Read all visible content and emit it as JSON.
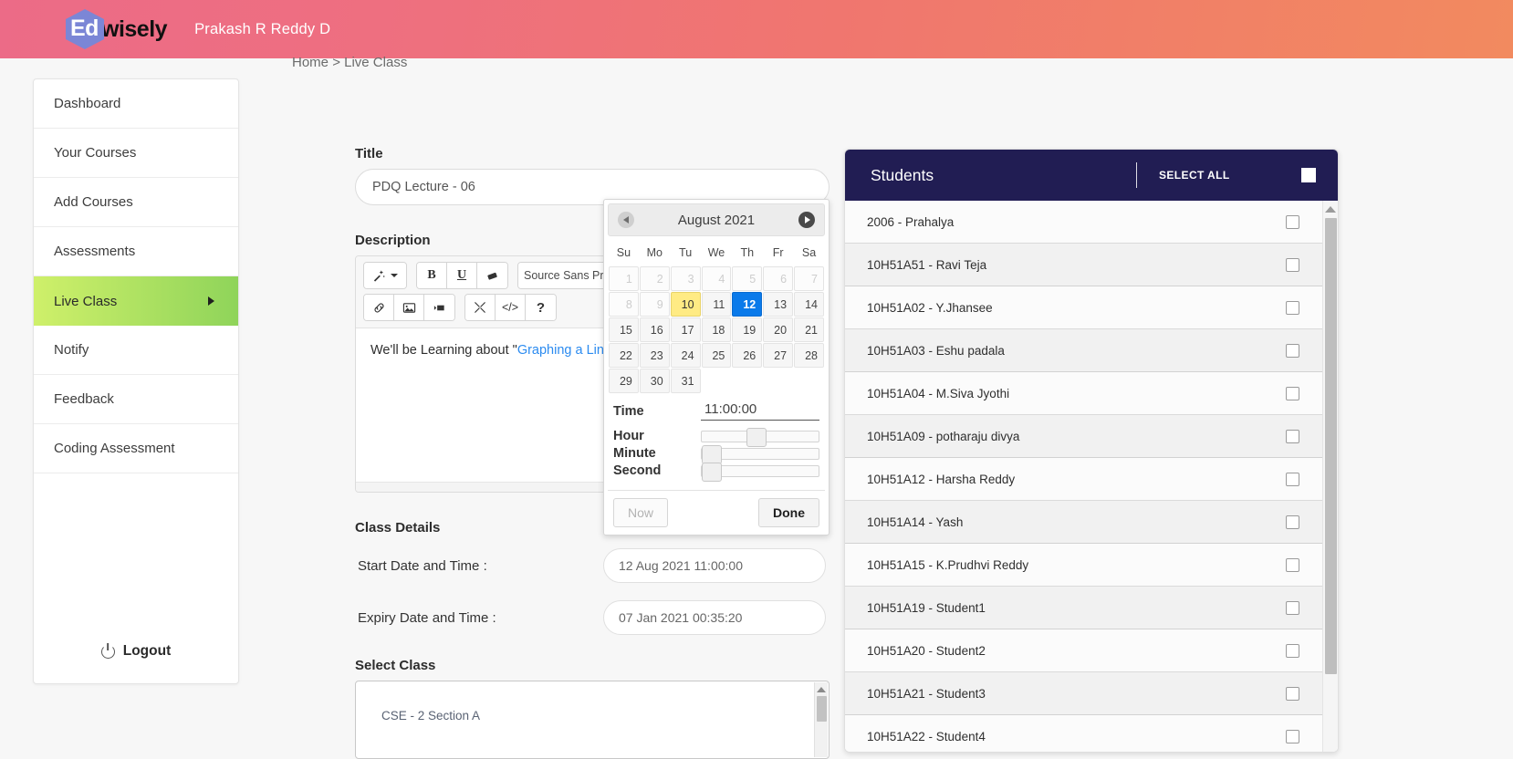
{
  "header": {
    "logo_ed": "Ed",
    "logo_wisely": "wisely",
    "user_name": "Prakash R Reddy D"
  },
  "breadcrumb": {
    "home": "Home",
    "separator": ">",
    "current": "Live Class",
    "full": "Home > Live Class"
  },
  "sidebar": {
    "items": [
      {
        "label": "Dashboard",
        "active": false
      },
      {
        "label": "Your Courses",
        "active": false
      },
      {
        "label": "Add Courses",
        "active": false
      },
      {
        "label": "Assessments",
        "active": false
      },
      {
        "label": "Live Class",
        "active": true
      },
      {
        "label": "Notify",
        "active": false
      },
      {
        "label": "Feedback",
        "active": false
      },
      {
        "label": "Coding Assessment",
        "active": false
      }
    ],
    "logout_label": "Logout"
  },
  "form": {
    "title_label": "Title",
    "title_value": "PDQ Lecture - 06",
    "title_placeholder": "Title",
    "description_label": "Description",
    "description_text_plain": "We'll be Learning about \"",
    "description_text_link": "Graphing a Line",
    "editor": {
      "font_name": "Source Sans Pro",
      "buttons_row1": [
        "magic-wand",
        "bold",
        "underline",
        "eraser"
      ],
      "bold_label": "B",
      "underline_label": "U",
      "buttons_row2": [
        "link",
        "image",
        "video",
        "fullscreen",
        "code",
        "help"
      ],
      "code_label": "</>",
      "help_label": "?"
    },
    "class_details_label": "Class Details",
    "start_label": "Start Date and Time :",
    "start_value": "12 Aug 2021 11:00:00",
    "expiry_label": "Expiry Date and Time :",
    "expiry_value": "07 Jan 2021 00:35:20",
    "select_class_label": "Select Class",
    "class_options": [
      "CSE - 2 Section A"
    ]
  },
  "datepicker": {
    "month_title": "August 2021",
    "prev_icon": "chevron-left-icon",
    "next_icon": "chevron-right-icon",
    "weekdays": [
      "Su",
      "Mo",
      "Tu",
      "We",
      "Th",
      "Fr",
      "Sa"
    ],
    "weeks": [
      [
        {
          "d": "1",
          "state": "dim"
        },
        {
          "d": "2",
          "state": "dim"
        },
        {
          "d": "3",
          "state": "dim"
        },
        {
          "d": "4",
          "state": "dim"
        },
        {
          "d": "5",
          "state": "dim"
        },
        {
          "d": "6",
          "state": "dim"
        },
        {
          "d": "7",
          "state": "dim"
        }
      ],
      [
        {
          "d": "8",
          "state": "dim"
        },
        {
          "d": "9",
          "state": "dim"
        },
        {
          "d": "10",
          "state": "today"
        },
        {
          "d": "11",
          "state": "normal"
        },
        {
          "d": "12",
          "state": "sel"
        },
        {
          "d": "13",
          "state": "normal"
        },
        {
          "d": "14",
          "state": "normal"
        }
      ],
      [
        {
          "d": "15",
          "state": "normal"
        },
        {
          "d": "16",
          "state": "normal"
        },
        {
          "d": "17",
          "state": "normal"
        },
        {
          "d": "18",
          "state": "normal"
        },
        {
          "d": "19",
          "state": "normal"
        },
        {
          "d": "20",
          "state": "normal"
        },
        {
          "d": "21",
          "state": "normal"
        }
      ],
      [
        {
          "d": "22",
          "state": "normal"
        },
        {
          "d": "23",
          "state": "normal"
        },
        {
          "d": "24",
          "state": "normal"
        },
        {
          "d": "25",
          "state": "normal"
        },
        {
          "d": "26",
          "state": "normal"
        },
        {
          "d": "27",
          "state": "normal"
        },
        {
          "d": "28",
          "state": "normal"
        }
      ],
      [
        {
          "d": "29",
          "state": "normal"
        },
        {
          "d": "30",
          "state": "normal"
        },
        {
          "d": "31",
          "state": "normal"
        },
        {
          "d": "",
          "state": "empty"
        },
        {
          "d": "",
          "state": "empty"
        },
        {
          "d": "",
          "state": "empty"
        },
        {
          "d": "",
          "state": "empty"
        }
      ]
    ],
    "time_label": "Time",
    "time_value": "11:00:00",
    "hour_label": "Hour",
    "minute_label": "Minute",
    "second_label": "Second",
    "hour_percent": 46,
    "minute_percent": 0,
    "second_percent": 0,
    "now_label": "Now",
    "done_label": "Done"
  },
  "students": {
    "panel_title": "Students",
    "select_all_label": "SELECT ALL",
    "rows": [
      {
        "name": "2006 - Prahalya",
        "checked": false
      },
      {
        "name": "10H51A51 - Ravi Teja",
        "checked": false
      },
      {
        "name": "10H51A02 - Y.Jhansee",
        "checked": false
      },
      {
        "name": "10H51A03 - Eshu padala",
        "checked": false
      },
      {
        "name": "10H51A04 - M.Siva Jyothi",
        "checked": false
      },
      {
        "name": "10H51A09 - potharaju divya",
        "checked": false
      },
      {
        "name": "10H51A12 - Harsha Reddy",
        "checked": false
      },
      {
        "name": "10H51A14 - Yash",
        "checked": false
      },
      {
        "name": "10H51A15 - K.Prudhvi Reddy",
        "checked": false
      },
      {
        "name": "10H51A19 - Student1",
        "checked": false
      },
      {
        "name": "10H51A20 - Student2",
        "checked": false
      },
      {
        "name": "10H51A21 - Student3",
        "checked": false
      },
      {
        "name": "10H51A22 - Student4",
        "checked": false
      }
    ]
  },
  "colors": {
    "header_gradient_start": "#ec6b87",
    "header_gradient_end": "#f28a5f",
    "sidebar_active_start": "#cff06a",
    "sidebar_active_end": "#8fd45a",
    "students_header": "#211d53",
    "date_selected": "#0a7aea",
    "date_today": "#ffeb84",
    "link": "#2b8bf0",
    "logo_hex": "#7b86d6"
  }
}
